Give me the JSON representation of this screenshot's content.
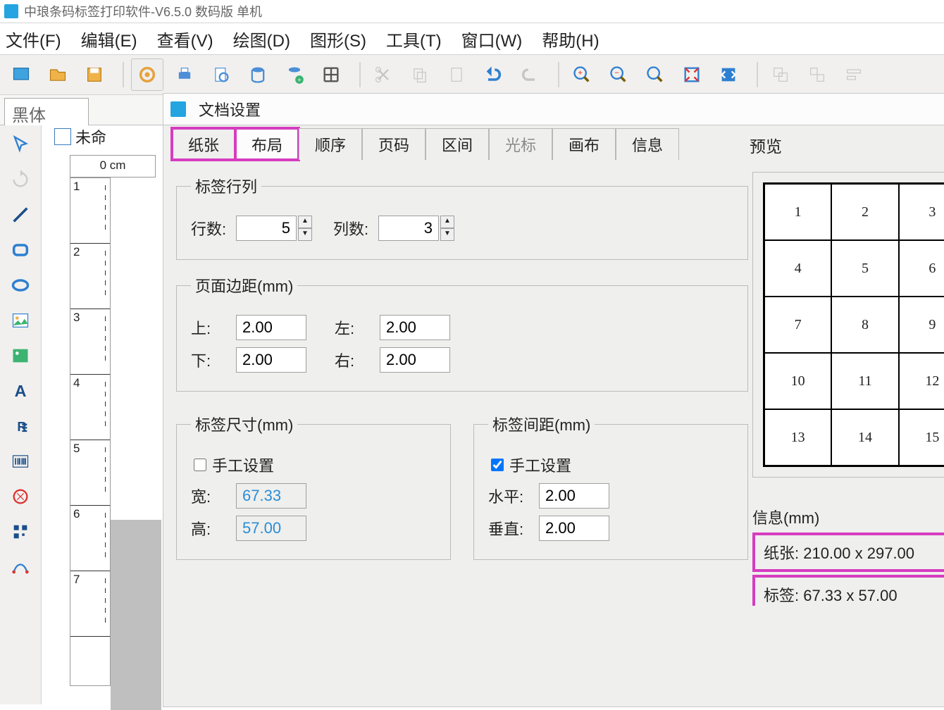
{
  "titlebar": {
    "app_title": "中琅条码标签打印软件-V6.5.0 数码版 单机"
  },
  "menu": {
    "file": "文件(F)",
    "edit": "编辑(E)",
    "view": "查看(V)",
    "draw": "绘图(D)",
    "shape": "图形(S)",
    "tool": "工具(T)",
    "window": "窗口(W)",
    "help": "帮助(H)"
  },
  "fontbar": {
    "font_name": "黑体"
  },
  "doc_tab": {
    "name": "未命"
  },
  "ruler": {
    "origin": "0 cm",
    "ticks": [
      "1",
      "2",
      "3",
      "4",
      "5",
      "6",
      "7"
    ]
  },
  "dialog": {
    "title": "文档设置",
    "tabs": {
      "paper": "纸张",
      "layout": "布局",
      "order": "顺序",
      "page": "页码",
      "range": "区间",
      "cursor": "光标",
      "canvas": "画布",
      "info": "信息"
    },
    "preview_label": "预览",
    "group_rowcol": {
      "legend": "标签行列",
      "rows_label": "行数:",
      "rows_value": "5",
      "cols_label": "列数:",
      "cols_value": "3"
    },
    "group_margin": {
      "legend": "页面边距(mm)",
      "top_label": "上:",
      "top_value": "2.00",
      "left_label": "左:",
      "left_value": "2.00",
      "bottom_label": "下:",
      "bottom_value": "2.00",
      "right_label": "右:",
      "right_value": "2.00"
    },
    "group_size": {
      "legend": "标签尺寸(mm)",
      "manual_label": "手工设置",
      "width_label": "宽:",
      "width_value": "67.33",
      "height_label": "高:",
      "height_value": "57.00"
    },
    "group_gap": {
      "legend": "标签间距(mm)",
      "manual_label": "手工设置",
      "h_label": "水平:",
      "h_value": "2.00",
      "v_label": "垂直:",
      "v_value": "2.00"
    },
    "preview_cells": [
      "1",
      "2",
      "3",
      "4",
      "5",
      "6",
      "7",
      "8",
      "9",
      "10",
      "11",
      "12",
      "13",
      "14",
      "15"
    ],
    "info": {
      "legend": "信息(mm)",
      "paper": "纸张: 210.00 x 297.00",
      "label": "标签: 67.33 x 57.00"
    }
  }
}
